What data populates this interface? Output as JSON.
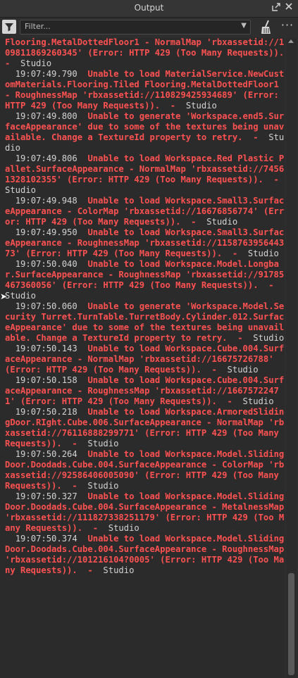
{
  "window": {
    "title": "Output"
  },
  "toolbar": {
    "filter_placeholder": "Filter...",
    "more_label": "···"
  },
  "log": [
    {
      "ts": "",
      "msg": "Flooring.MetalDottedFloor1 - NormalMap 'rbxassetid://109811869260345' (Error: HTTP 429 (Too Many Requests)).",
      "src": "Studio"
    },
    {
      "ts": "19:07:49.790",
      "msg": "Unable to load MaterialService.NewCustomMaterials.Flooring.Tiled Flooring.MetalDottedFloor1 - RoughnessMap 'rbxassetid://110829425934689' (Error: HTTP 429 (Too Many Requests)).",
      "src": "Studio"
    },
    {
      "ts": "19:07:49.800",
      "msg": "Unable to generate 'Workspace.end5.SurfaceAppearance' due to some of the textures being unavailable. Change a TextureId property to retry.",
      "src": "Studio"
    },
    {
      "ts": "19:07:49.806",
      "msg": "Unable to load Workspace.Red Plastic Pallet.SurfaceAppearance - NormalMap 'rbxassetid://74561328102355' (Error: HTTP 429 (Too Many Requests)).",
      "src": "Studio"
    },
    {
      "ts": "19:07:49.948",
      "msg": "Unable to load Workspace.Small3.SurfaceAppearance - ColorMap 'rbxassetid://16676856774' (Error: HTTP 429 (Too Many Requests)).",
      "src": "Studio"
    },
    {
      "ts": "19:07:49.950",
      "msg": "Unable to load Workspace.Small3.SurfaceAppearance - RoughnessMap 'rbxassetid://115876395644373' (Error: HTTP 429 (Too Many Requests)).",
      "src": "Studio"
    },
    {
      "ts": "19:07:50.040",
      "msg": "Unable to load Workspace.Model.Longbar.SurfaceAppearance - RoughnessMap 'rbxassetid://91785467360056' (Error: HTTP 429 (Too Many Requests)).",
      "src": "Studio"
    },
    {
      "ts": "19:07:50.060",
      "msg": "Unable to generate 'Workspace.Model.Security Turret.TurnTable.TurretBody.Cylinder.012.SurfaceAppearance' due to some of the textures being unavailable. Change a TextureId property to retry.",
      "src": "Studio"
    },
    {
      "ts": "19:07:50.143",
      "msg": "Unable to load Workspace.Cube.004.SurfaceAppearance - NormalMap 'rbxassetid://16675726788' (Error: HTTP 429 (Too Many Requests)).",
      "src": "Studio"
    },
    {
      "ts": "19:07:50.158",
      "msg": "Unable to load Workspace.Cube.004.SurfaceAppearance - RoughnessMap 'rbxassetid://16675722471' (Error: HTTP 429 (Too Many Requests)).",
      "src": "Studio"
    },
    {
      "ts": "19:07:50.218",
      "msg": "Unable to load Workspace.ArmoredSlidingDoor.RIght.Cube.006.SurfaceAppearance - NormalMap 'rbxassetid://76116888299771' (Error: HTTP 429 (Too Many Requests)).",
      "src": "Studio"
    },
    {
      "ts": "19:07:50.264",
      "msg": "Unable to load Workspace.Model.SlidingDoor.Doodads.Cube.004.SurfaceAppearance - ColorMap 'rbxassetid://92586406005090' (Error: HTTP 429 (Too Many Requests)).",
      "src": "Studio"
    },
    {
      "ts": "19:07:50.327",
      "msg": "Unable to load Workspace.Model.SlidingDoor.Doodads.Cube.004.SurfaceAppearance - MetalnessMap 'rbxassetid://111827338251179' (Error: HTTP 429 (Too Many Requests)).",
      "src": "Studio"
    },
    {
      "ts": "19:07:50.374",
      "msg": "Unable to load Workspace.Model.SlidingDoor.Doodads.Cube.004.SurfaceAppearance - RoughnessMap 'rbxassetid://101216104?0005' (Error: HTTP 429 (Too Many Requests)).",
      "src": "Studio"
    }
  ],
  "colors": {
    "error": "#ff5151",
    "meta": "#d3d3d3",
    "background": "#2b2b2b"
  }
}
